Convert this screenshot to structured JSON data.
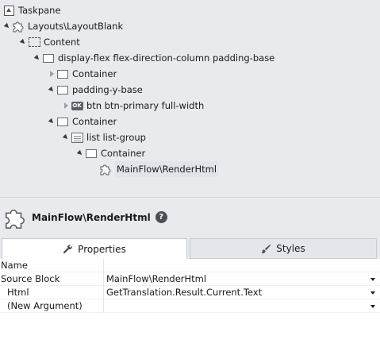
{
  "tree": {
    "root": "Taskpane",
    "layout": "Layouts\\LayoutBlank",
    "content": "Content",
    "flex": "display-flex flex-direction-column padding-base",
    "container1": "Container",
    "padding": "padding-y-base",
    "btn_badge": "OK",
    "btn": "btn btn-primary full-width",
    "container2": "Container",
    "list": "list list-group",
    "container3": "Container",
    "render": "MainFlow\\RenderHtml"
  },
  "header": {
    "title": "MainFlow\\RenderHtml",
    "help": "?"
  },
  "tabs": {
    "properties": "Properties",
    "styles": "Styles"
  },
  "properties": [
    {
      "name": "Name",
      "value": "",
      "dropdown": false
    },
    {
      "name": "Source Block",
      "value": "MainFlow\\RenderHtml",
      "dropdown": true
    },
    {
      "name": "Html",
      "value": "GetTranslation.Result.Current.Text",
      "dropdown": true
    },
    {
      "name": "(New Argument)",
      "value": "",
      "dropdown": true
    }
  ]
}
